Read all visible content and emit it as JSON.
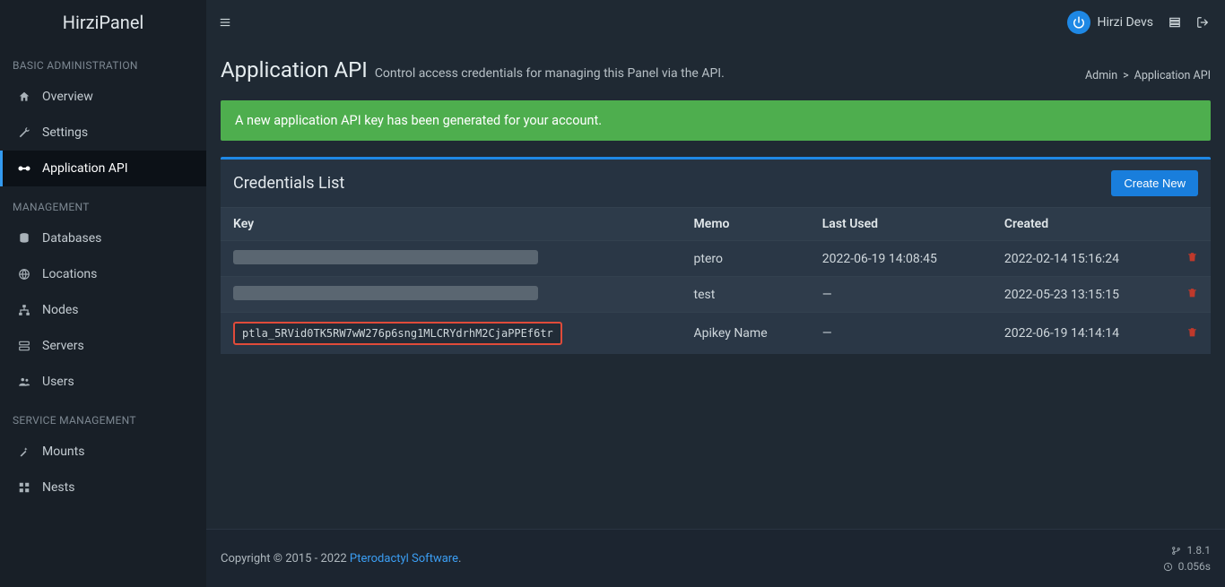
{
  "brand": "HirziPanel",
  "topbar": {
    "username": "Hirzi Devs"
  },
  "sidebar": {
    "sections": {
      "basic": "BASIC ADMINISTRATION",
      "mgmt": "MANAGEMENT",
      "service": "SERVICE MANAGEMENT"
    },
    "overview": "Overview",
    "settings": "Settings",
    "api": "Application API",
    "databases": "Databases",
    "locations": "Locations",
    "nodes": "Nodes",
    "servers": "Servers",
    "users": "Users",
    "mounts": "Mounts",
    "nests": "Nests"
  },
  "page": {
    "title": "Application API",
    "subtitle": "Control access credentials for managing this Panel via the API."
  },
  "breadcrumb": {
    "admin": "Admin",
    "sep": ">",
    "current": "Application API"
  },
  "alert": "A new application API key has been generated for your account.",
  "box": {
    "title": "Credentials List",
    "create": "Create New"
  },
  "table": {
    "headers": {
      "key": "Key",
      "memo": "Memo",
      "last_used": "Last Used",
      "created": "Created"
    },
    "rows": [
      {
        "key_hidden": true,
        "key": "",
        "memo": "ptero",
        "last_used": "2022-06-19 14:08:45",
        "created": "2022-02-14 15:16:24"
      },
      {
        "key_hidden": true,
        "key": "",
        "memo": "test",
        "last_used": "—",
        "created": "2022-05-23 13:15:15"
      },
      {
        "key_hidden": false,
        "key": "ptla_5RVid0TK5RW7wW276p6sng1MLCRYdrhM2CjaPPEf6tr",
        "memo": "Apikey Name",
        "last_used": "—",
        "created": "2022-06-19 14:14:14"
      }
    ]
  },
  "footer": {
    "text_prefix": "Copyright © 2015 - 2022 ",
    "link": "Pterodactyl Software",
    "text_suffix": ".",
    "version": "1.8.1",
    "time": "0.056s"
  }
}
